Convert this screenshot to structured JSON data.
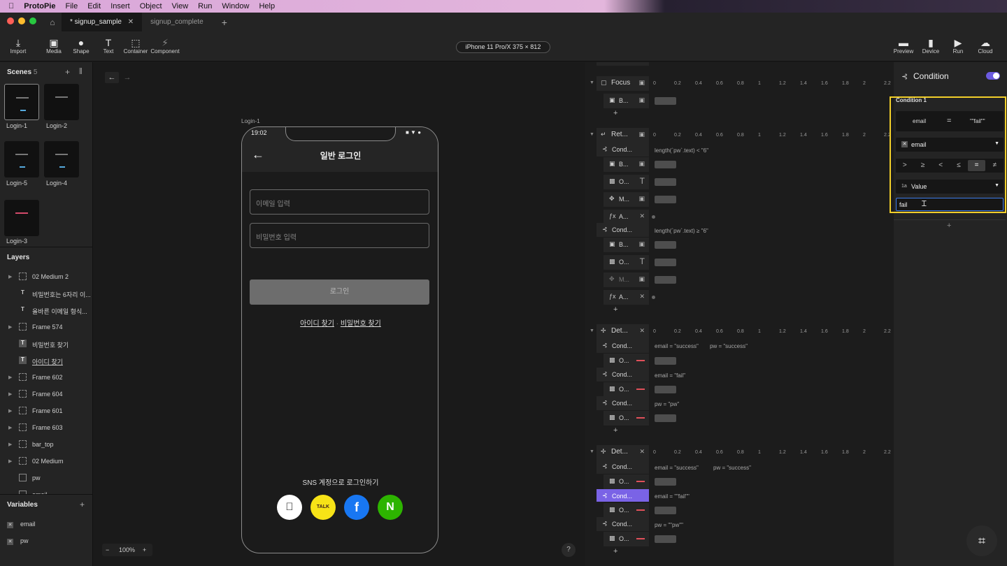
{
  "menubar": {
    "app": "ProtoPie",
    "items": [
      "File",
      "Edit",
      "Insert",
      "Object",
      "View",
      "Run",
      "Window",
      "Help"
    ]
  },
  "tabs": {
    "active": "* signup_sample",
    "inactive": "signup_complete"
  },
  "toolbar": {
    "left": [
      "Import",
      "Media",
      "Shape",
      "Text",
      "Container",
      "Component"
    ],
    "device": "iPhone 11 Pro/X  375 × 812",
    "right": [
      "Preview",
      "Device",
      "Run",
      "Cloud"
    ]
  },
  "scenes": {
    "title": "Scenes",
    "count": "5",
    "items": [
      "Login-1",
      "Login-2",
      "Login-5",
      "Login-4",
      "Login-3"
    ]
  },
  "layers": {
    "title": "Layers",
    "items": [
      "02 Medium 2",
      "비밀번호는 6자리 이...",
      "올바른 이메일 형식...",
      "Frame 574",
      "비밀번호 찾기",
      "아이디 찾기",
      "Frame 602",
      "Frame 604",
      "Frame 601",
      "Frame 603",
      "bar_top",
      "02 Medium",
      "pw",
      "email"
    ]
  },
  "variables": {
    "title": "Variables",
    "items": [
      "email",
      "pw"
    ]
  },
  "canvas": {
    "scene_label": "Login-1",
    "zoom": "100%"
  },
  "phone": {
    "time": "19:02",
    "title": "일반 로그인",
    "email_placeholder": "이메일 입력",
    "pw_placeholder": "비밀번호 입력",
    "login": "로그인",
    "find_id": "아이디 찾기",
    "find_pw": "비밀번호 찾기",
    "sns_label": "SNS 계정으로 로그인하기",
    "kakao": "TALK",
    "facebook": "f",
    "naver": "N"
  },
  "timeline": {
    "ruler": [
      "0",
      "0.2",
      "0.4",
      "0.6",
      "0.8",
      "1",
      "1.2",
      "1.4",
      "1.6",
      "1.8",
      "2",
      "2.2"
    ],
    "focus": "Focus",
    "ret": "Ret...",
    "det": "Det...",
    "cond": "Cond...",
    "b": "B...",
    "o": "O...",
    "m": "M...",
    "a": "A...",
    "expr_ret1": "length(`pw`.text) < \"6\"",
    "expr_ret2": "length(`pw`.text) ≥ \"6\"",
    "expr_d1a": "email = \"success\"",
    "expr_d1b": "pw = \"success\"",
    "expr_d1c": "email = \"fail\"",
    "expr_d1d": "pw = \"pw\"",
    "expr_d2a": "email = \"success\"",
    "expr_d2b": "pw = \"success\"",
    "expr_d2c": "email = \"\"fail\"\"",
    "expr_d2d": "pw = \"\"pw\"\""
  },
  "condition": {
    "title": "Condition",
    "enabled": true,
    "label": "Condition 1",
    "left": "email",
    "eq": "=",
    "right": "\"\"fail\"\"",
    "variable": "email",
    "operators": [
      ">",
      "≥",
      "<",
      "≤",
      "=",
      "≠"
    ],
    "selected_operator": "=",
    "value_type": "Value",
    "value_type_icon": "1a",
    "value_input": "fail"
  },
  "colors": {
    "accent": "#7a63e6",
    "highlight": "#f2cf2a",
    "danger": "#e0505a",
    "kakao": "#f7e317",
    "facebook": "#1877f2",
    "naver": "#2db400"
  }
}
